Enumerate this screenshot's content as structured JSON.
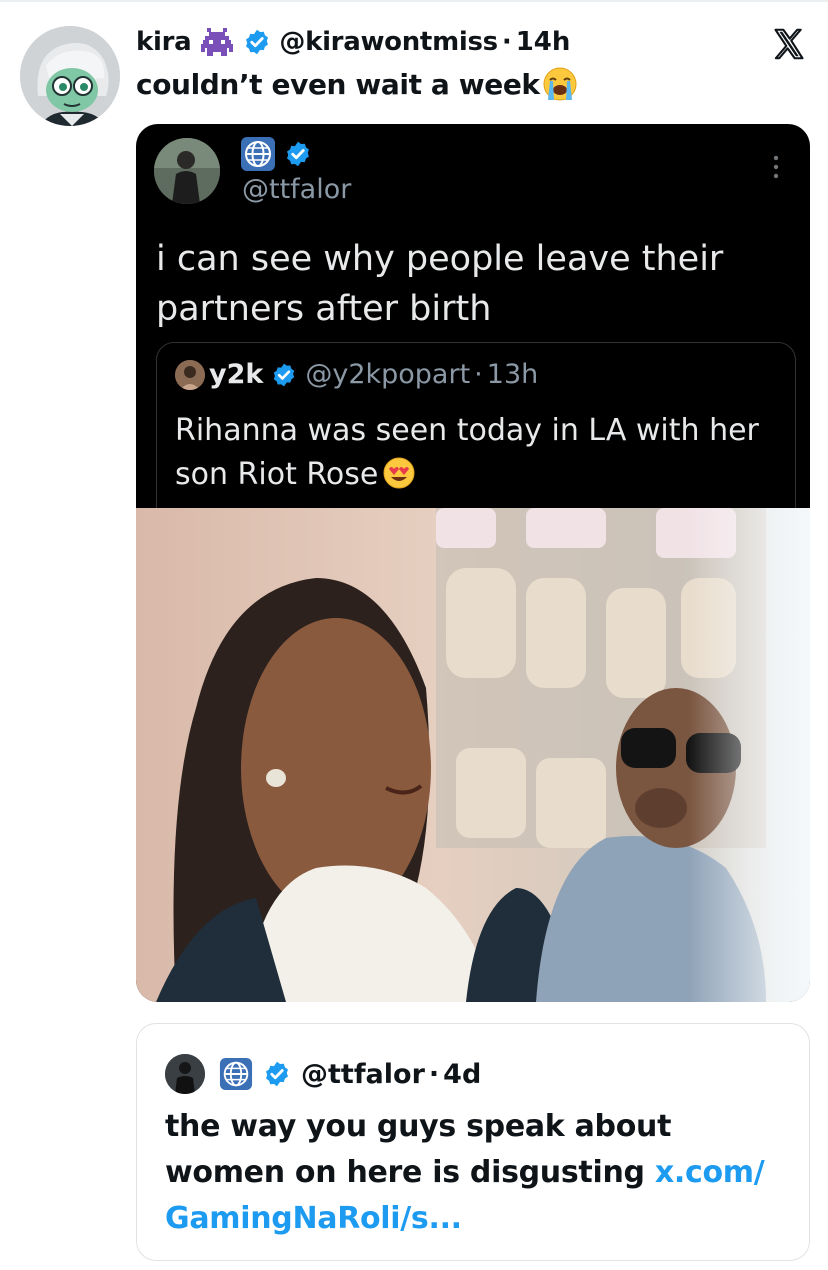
{
  "tweet": {
    "author_name": "kira",
    "author_emoji": "alien-monster-emoji",
    "handle": "@kirawontmiss",
    "separator": "·",
    "time": "14h",
    "text": "couldn’t even wait a week",
    "text_emoji": "loudly-crying-face-emoji",
    "logo": "x-logo-icon"
  },
  "screenshot": {
    "handle": "@ttfalor",
    "text": "i can see why people leave their partners after birth",
    "quoted": {
      "name": "y2k",
      "handle": "@y2kpopart",
      "separator": "·",
      "time": "13h",
      "text": "Rihanna was seen today in LA with her son Riot Rose",
      "text_emoji": "smiling-face-with-heart-eyes-emoji"
    }
  },
  "quote_card": {
    "handle": "@ttfalor",
    "separator": "·",
    "time": "4d",
    "text": "the way you guys speak about women on here is disgusting",
    "link_text": "x.com/ GamingNaRoli/s..."
  },
  "colors": {
    "link": "#1d9bf0",
    "verified": "#1d9bf0",
    "text": "#0f1419",
    "dark_bg": "#000000",
    "dark_text": "#e7e9ea",
    "dark_secondary": "#8b98a5"
  }
}
